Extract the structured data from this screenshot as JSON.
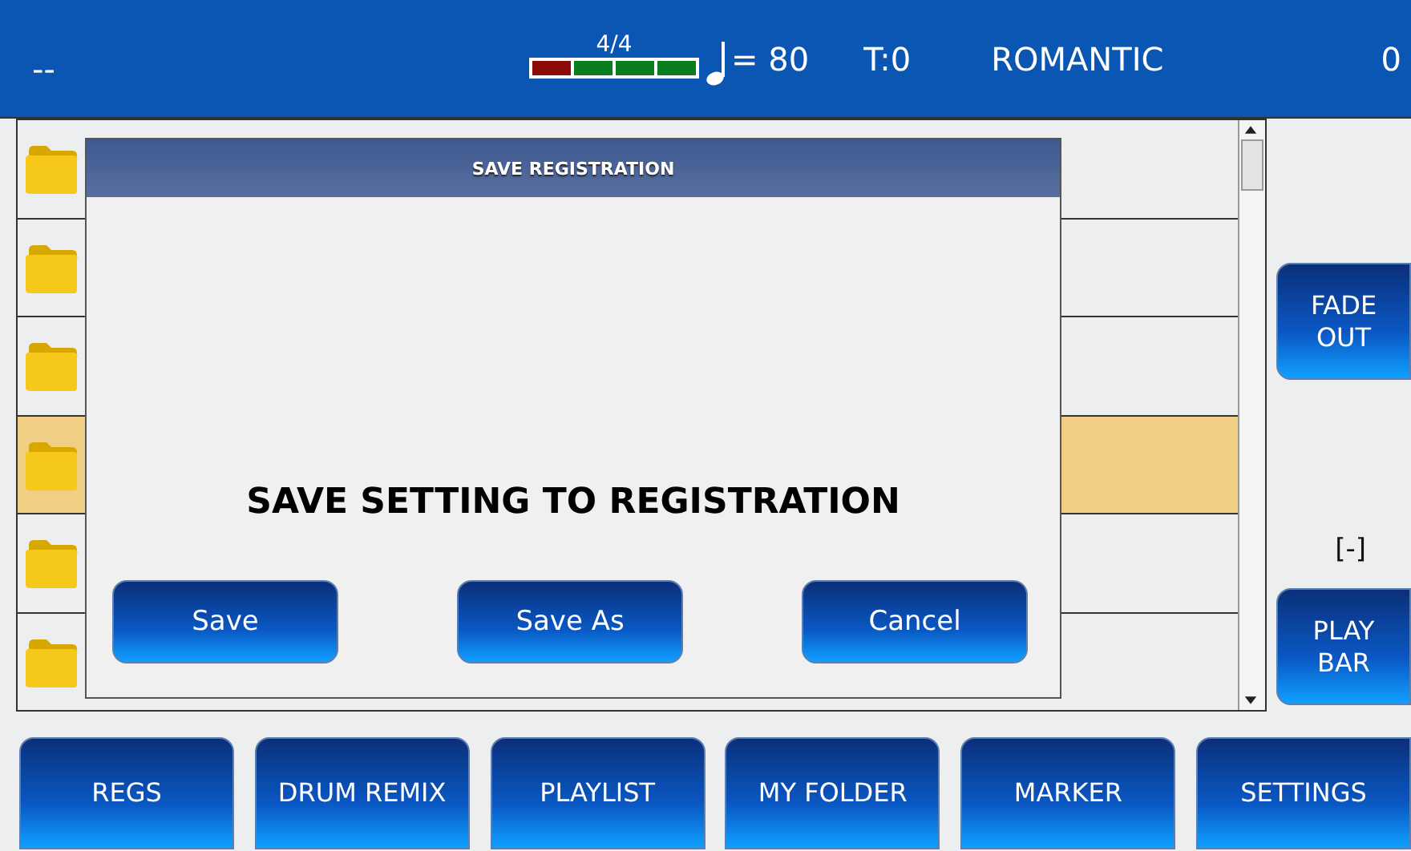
{
  "top_bar": {
    "left": "--",
    "meter": {
      "signature": "4/4",
      "beats": [
        {
          "color": "#8b0a0a"
        },
        {
          "color": "#0a7d1e"
        },
        {
          "color": "#0a7d1e"
        },
        {
          "color": "#0a7d1e"
        }
      ]
    },
    "tempo": "= 80",
    "transpose": "T:0",
    "style": "ROMANTIC",
    "counter": "0"
  },
  "list": {
    "rows": [
      {
        "selected": false
      },
      {
        "selected": false
      },
      {
        "selected": false
      },
      {
        "selected": true
      },
      {
        "selected": false
      },
      {
        "selected": false
      }
    ]
  },
  "side_panel": {
    "buttons": [
      {
        "label": "FADE OUT"
      },
      {
        "label": "PLAY BAR"
      }
    ],
    "marker": "[-]"
  },
  "dialog": {
    "title": "SAVE REGISTRATION",
    "message": "SAVE SETTING TO REGISTRATION",
    "buttons": [
      "Save",
      "Save As",
      "Cancel"
    ]
  },
  "bottom_buttons": [
    "REGS",
    "DRUM REMIX",
    "PLAYLIST",
    "MY FOLDER",
    "MARKER",
    "SETTINGS"
  ]
}
